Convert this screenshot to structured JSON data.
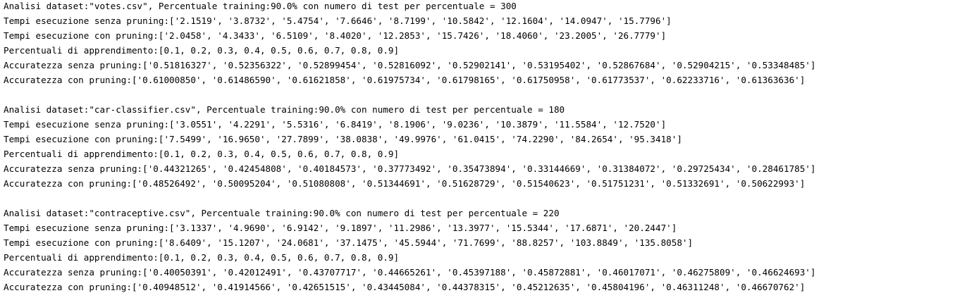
{
  "blocks": [
    {
      "lines": [
        "Analisi dataset:\"votes.csv\", Percentuale training:90.0% con numero di test per percentuale = 300",
        "Tempi esecuzione senza pruning:['2.1519', '3.8732', '5.4754', '7.6646', '8.7199', '10.5842', '12.1604', '14.0947', '15.7796']",
        "Tempi esecuzione con pruning:['2.0458', '4.3433', '6.5109', '8.4020', '12.2853', '15.7426', '18.4060', '23.2005', '26.7779']",
        "Percentuali di apprendimento:[0.1, 0.2, 0.3, 0.4, 0.5, 0.6, 0.7, 0.8, 0.9]",
        "Accuratezza senza pruning:['0.51816327', '0.52356322', '0.52899454', '0.52816092', '0.52902141', '0.53195402', '0.52867684', '0.52904215', '0.53348485']",
        "Accuratezza con pruning:['0.61000850', '0.61486590', '0.61621858', '0.61975734', '0.61798165', '0.61750958', '0.61773537', '0.62233716', '0.61363636']"
      ]
    },
    {
      "lines": [
        "Analisi dataset:\"car-classifier.csv\", Percentuale training:90.0% con numero di test per percentuale = 180",
        "Tempi esecuzione senza pruning:['3.0551', '4.2291', '5.5316', '6.8419', '8.1906', '9.0236', '10.3879', '11.5584', '12.7520']",
        "Tempi esecuzione con pruning:['7.5499', '16.9650', '27.7899', '38.0838', '49.9976', '61.0415', '74.2290', '84.2654', '95.3418']",
        "Percentuali di apprendimento:[0.1, 0.2, 0.3, 0.4, 0.5, 0.6, 0.7, 0.8, 0.9]",
        "Accuratezza senza pruning:['0.44321265', '0.42454808', '0.40184573', '0.37773492', '0.35473894', '0.33144669', '0.31384072', '0.29725434', '0.28461785']",
        "Accuratezza con pruning:['0.48526492', '0.50095204', '0.51080808', '0.51344691', '0.51628729', '0.51540623', '0.51751231', '0.51332691', '0.50622993']"
      ]
    },
    {
      "lines": [
        "Analisi dataset:\"contraceptive.csv\", Percentuale training:90.0% con numero di test per percentuale = 220",
        "Tempi esecuzione senza pruning:['3.1337', '4.9690', '6.9142', '9.1897', '11.2986', '13.3977', '15.5344', '17.6871', '20.2447']",
        "Tempi esecuzione con pruning:['8.6409', '15.1207', '24.0681', '37.1475', '45.5944', '71.7699', '88.8257', '103.8849', '135.8058']",
        "Percentuali di apprendimento:[0.1, 0.2, 0.3, 0.4, 0.5, 0.6, 0.7, 0.8, 0.9]",
        "Accuratezza senza pruning:['0.40050391', '0.42012491', '0.43707717', '0.44665261', '0.45397188', '0.45872881', '0.46017071', '0.46275809', '0.46624693']",
        "Accuratezza con pruning:['0.40948512', '0.41914566', '0.42651515', '0.43445084', '0.44378315', '0.45212635', '0.45804196', '0.46311248', '0.46670762']"
      ]
    }
  ]
}
